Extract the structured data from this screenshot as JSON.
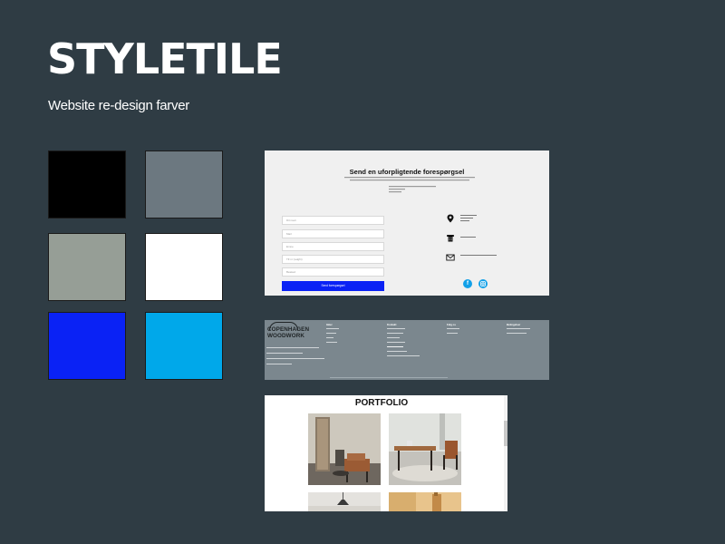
{
  "header": {
    "title": "STYLETILE",
    "subtitle": "Website re-design farver"
  },
  "palette": {
    "colors": [
      "#000000",
      "#6c7880",
      "#969e96",
      "#ffffff",
      "#0a22f5",
      "#00a8ea"
    ]
  },
  "contact": {
    "heading": "Send en uforpligtende forespørgsel",
    "fields": [
      "Dit navn",
      "Mail",
      "Emne",
      "Tlf.nr (valgfri)",
      "Besked"
    ],
    "button_label": "Send forespørgsel",
    "icons": [
      "location-pin-icon",
      "phone-icon",
      "mail-icon",
      "facebook-icon",
      "instagram-icon"
    ]
  },
  "footer": {
    "logo": "COPENHAGEN WOODWORK",
    "columns": [
      {
        "heading": "Idéer"
      },
      {
        "heading": "Kontakt"
      },
      {
        "heading": "Følg os"
      },
      {
        "heading": "Betingelser"
      }
    ]
  },
  "portfolio": {
    "title": "PORTFOLIO"
  }
}
